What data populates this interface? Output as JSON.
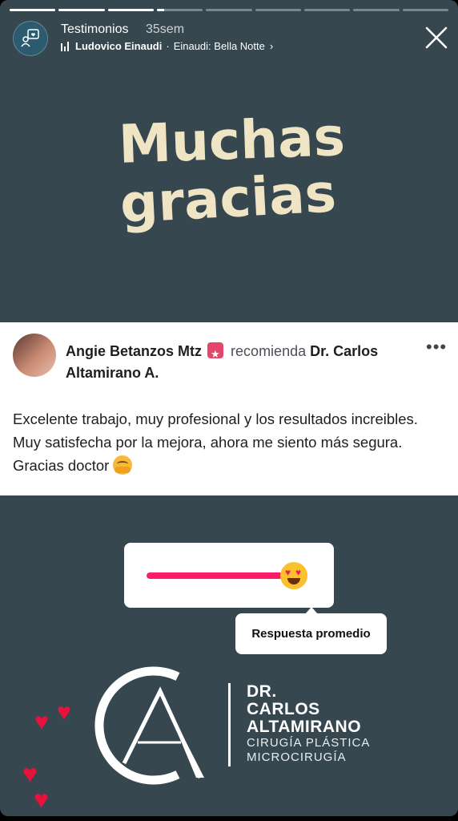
{
  "progress": {
    "segments": [
      1,
      1,
      1,
      0.15,
      0,
      0,
      0,
      0,
      0
    ]
  },
  "header": {
    "account": "Testimonios",
    "age": "35sem",
    "music_artist": "Ludovico Einaudi",
    "music_separator": "·",
    "music_track": "Einaudi: Bella Notte"
  },
  "gracias_art": {
    "line1": "Muchas",
    "line2": "gracias"
  },
  "recommendation": {
    "reviewer": "Angie Betanzos Mtz",
    "verb": "recomienda",
    "target": "Dr. Carlos Altamirano A.",
    "more": "•••",
    "text": "Excelente trabajo, muy profesional y los resultados increibles. Muy satisfecha por la mejora, ahora me siento más segura. Gracias doctor"
  },
  "slider": {
    "value": 0.92,
    "emoji": "heart-eyes-emoji",
    "accent": "#fe1b6b"
  },
  "average": {
    "label": "Respuesta promedio"
  },
  "logo": {
    "dr": "DR.",
    "name1": "CARLOS",
    "name2": "ALTAMIRANO",
    "sub1": "CIRUGÍA PLÁSTICA",
    "sub2": "MICROCIRUGÍA"
  },
  "colors": {
    "background": "#36474f",
    "heart": "#e8123c",
    "badge": "#e4466a"
  }
}
